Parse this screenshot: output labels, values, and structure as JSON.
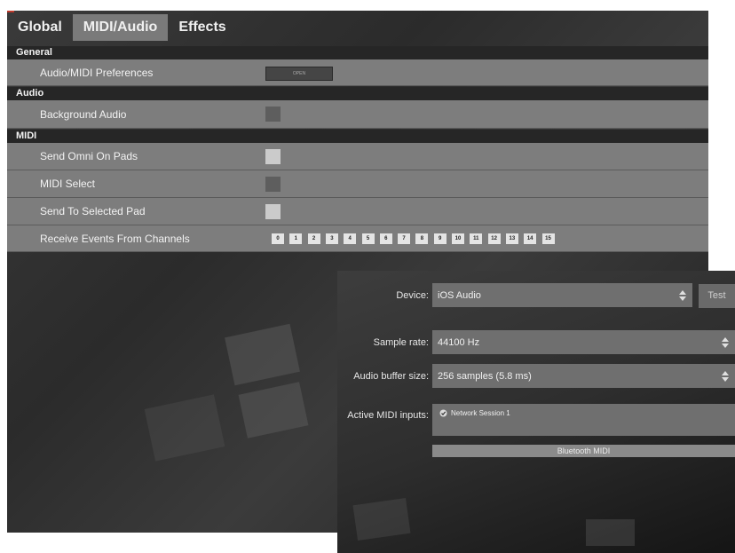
{
  "tabs": [
    {
      "label": "Global",
      "active": false
    },
    {
      "label": "MIDI/Audio",
      "active": true
    },
    {
      "label": "Effects",
      "active": false
    }
  ],
  "sections": {
    "general": "General",
    "audio": "Audio",
    "midi": "MIDI"
  },
  "rows": {
    "audio_midi_prefs": {
      "label": "Audio/MIDI Preferences",
      "button": "OPEN"
    },
    "background_audio": {
      "label": "Background Audio",
      "checked": false
    },
    "send_omni": {
      "label": "Send Omni On Pads",
      "checked": true
    },
    "midi_select": {
      "label": "MIDI Select",
      "checked": false
    },
    "send_selected": {
      "label": "Send To Selected Pad",
      "checked": true
    },
    "receive_channels": {
      "label": "Receive Events From Channels",
      "channels": [
        "0",
        "1",
        "2",
        "3",
        "4",
        "5",
        "6",
        "7",
        "8",
        "9",
        "10",
        "11",
        "12",
        "13",
        "14",
        "15"
      ]
    }
  },
  "audio_panel": {
    "device_label": "Device:",
    "device_value": "iOS Audio",
    "test_label": "Test",
    "sample_rate_label": "Sample rate:",
    "sample_rate_value": "44100 Hz",
    "buffer_label": "Audio buffer size:",
    "buffer_value": "256 samples (5.8 ms)",
    "midi_inputs_label": "Active MIDI inputs:",
    "midi_inputs": [
      {
        "name": "Network Session 1",
        "checked": true
      }
    ],
    "bluetooth_label": "Bluetooth MIDI"
  },
  "colors": {
    "row_bg": "#7d7d7d",
    "section_bg": "#262626",
    "active_tab": "#7a7a7a"
  }
}
